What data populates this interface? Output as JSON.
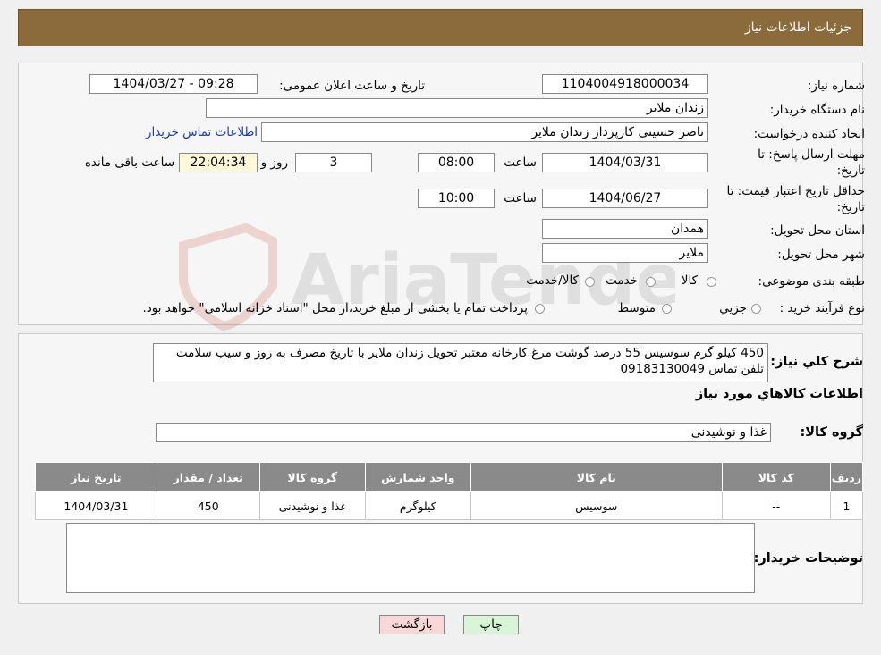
{
  "header": {
    "title": "جزئیات اطلاعات نیاز"
  },
  "watermark": {
    "text": "AriaTender.neT"
  },
  "fields": {
    "need_number_label": "شماره نیاز:",
    "need_number": "1104004918000034",
    "announce_label": "تاریخ و ساعت اعلان عمومی:",
    "announce_value": "1404/03/27 - 09:28",
    "buyer_org_label": "نام دستگاه خریدار:",
    "buyer_org": "زندان ملایر",
    "creator_label": "ایجاد کننده درخواست:",
    "creator": "ناصر  حسینی کارپرداز زندان ملایر",
    "buyer_contact_link": "اطلاعات تماس خریدار",
    "deadline_label_line1": "مهلت ارسال پاسخ: تا",
    "deadline_label_line2": "تاریخ:",
    "deadline_date": "1404/03/31",
    "time_label": "ساعت",
    "deadline_time": "08:00",
    "days_count": "3",
    "days_label": "روز و",
    "remaining_time": "22:04:34",
    "remaining_label": "ساعت باقی مانده",
    "validity_label_line1": "حداقل تاریخ اعتبار قیمت: تا",
    "validity_label_line2": "تاریخ:",
    "validity_date": "1404/06/27",
    "validity_time": "10:00",
    "province_label": "استان محل تحویل:",
    "province": "همدان",
    "city_label": "شهر محل تحویل:",
    "city": "ملایر",
    "category_label": "طبقه بندی موضوعی:",
    "category_options": [
      "کالا",
      "خدمت",
      "کالا/خدمت"
    ],
    "process_label": "نوع فرآیند خرید :",
    "process_options": [
      "جزیي",
      "متوسط"
    ],
    "process_note": "پرداخت تمام یا بخشی از مبلغ خرید،از محل \"اسناد خزانه اسلامی\" خواهد بود."
  },
  "summary": {
    "label": "شرح کلي نياز:",
    "text": "450 کیلو گرم سوسیس 55 درصد گوشت مرغ کارخانه معتبر تحویل زندان ملایر با تاریخ مصرف به روز و سیب سلامت تلفن تماس 09183130049"
  },
  "goods": {
    "section_title": "اطلاعات کالاهاي مورد نياز",
    "group_label": "گروه کالا:",
    "group_value": "غذا و نوشیدنی",
    "columns": [
      "ردیف",
      "کد کالا",
      "نام کالا",
      "واحد شمارش",
      "گروه کالا",
      "تعداد / مقدار",
      "تاریخ نیاز"
    ],
    "rows": [
      [
        "1",
        "--",
        "سوسیس",
        "کیلوگرم",
        "غذا و نوشیدنی",
        "450",
        "1404/03/31"
      ]
    ]
  },
  "buyer_notes": {
    "label": "توضیحات خریدار:",
    "value": ""
  },
  "buttons": {
    "print": "چاپ",
    "back": "بازگشت"
  }
}
